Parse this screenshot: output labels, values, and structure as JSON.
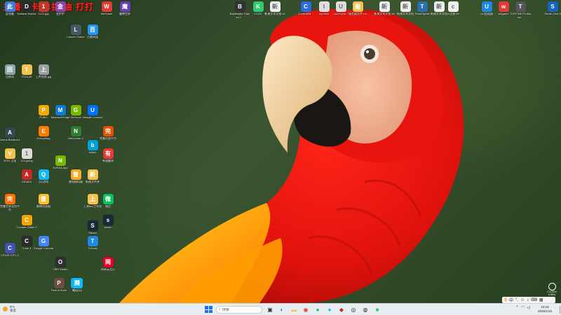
{
  "overlay": {
    "title": "主播打卡 单挑/油 打打"
  },
  "colors": {
    "overlay_red": "#ff2a2a",
    "taskbar_bg": "#e8edf2",
    "accent": "#1a73e8"
  },
  "desktop_icons": [
    {
      "label": "此电脑",
      "icon": "computer-icon",
      "color": "#3b7dd8"
    },
    {
      "label": "Darkest Mouse",
      "icon": "app-icon",
      "color": "#2b2b2b"
    },
    {
      "label": "1122.jpg",
      "icon": "image-icon",
      "color": "#c0392b"
    },
    {
      "label": "金铲铲",
      "icon": "game-icon",
      "color": "#8e44ad"
    },
    {
      "label": "WeGame",
      "icon": "wegame-icon",
      "color": "#e53935"
    },
    {
      "label": "魔兽世界",
      "icon": "game-icon",
      "color": "#6a3fb5"
    },
    {
      "label": "Battlestate Games L...",
      "icon": "launcher-icon",
      "color": "#333333"
    },
    {
      "label": "KOOK",
      "icon": "kook-icon",
      "color": "#2ecc71"
    },
    {
      "label": "新建文本文档.txt",
      "icon": "text-file-icon",
      "color": "#eeeeee"
    },
    {
      "label": "ConsoleM...",
      "icon": "file-icon",
      "color": "#2d6cdf"
    },
    {
      "label": "Inputbin",
      "icon": "file-icon",
      "color": "#dddddd"
    },
    {
      "label": "UserSyne...",
      "icon": "file-icon",
      "color": "#dddddd"
    },
    {
      "label": "服务器文件.rar",
      "icon": "folder-icon",
      "color": "#f2c14e"
    },
    {
      "label": "新建文本文档.txt",
      "icon": "text-file-icon",
      "color": "#eeeeee"
    },
    {
      "label": "新建文本文档",
      "icon": "text-file-icon",
      "color": "#eeeeee"
    },
    {
      "label": "TeamSpeak",
      "icon": "teamspeak-icon",
      "color": "#2a6fb0"
    },
    {
      "label": "新建文本文档",
      "icon": "text-file-icon",
      "color": "#eeeeee"
    },
    {
      "label": "cs注册.txt",
      "icon": "text-file-icon",
      "color": "#eeeeee"
    },
    {
      "label": "UU加速器",
      "icon": "uu-icon",
      "color": "#1e88e5"
    },
    {
      "label": "wegame",
      "icon": "wegame-icon",
      "color": "#e53935"
    },
    {
      "label": "TOPFINE Professio...",
      "icon": "app-icon",
      "color": "#555555"
    },
    {
      "label": "Studio One 6",
      "icon": "studio-icon",
      "color": "#1565c0"
    },
    {
      "label": "Steam",
      "icon": "steam-icon",
      "color": "#1b2838"
    },
    {
      "label": "QQ",
      "icon": "qq-icon",
      "color": "#12b7f5"
    },
    {
      "label": "Path of Exile",
      "icon": "game-icon",
      "color": "#6d4c41"
    },
    {
      "label": "网易云音乐",
      "icon": "music-icon",
      "color": "#e60026"
    },
    {
      "label": "Google Chrome",
      "icon": "chrome-icon",
      "color": "#4285f4"
    },
    {
      "label": "OBS Studio",
      "icon": "obs-icon",
      "color": "#302e31"
    },
    {
      "label": "Microsoft Edge",
      "icon": "edge-icon",
      "color": "#0c7cd5"
    },
    {
      "label": "Everything",
      "icon": "search-app-icon",
      "color": "#ff7b00"
    },
    {
      "label": "ToDesk",
      "icon": "todesk-icon",
      "color": "#1e88e5"
    },
    {
      "label": "bilibili",
      "icon": "bilibili-icon",
      "color": "#00a1d6"
    },
    {
      "label": "有道翻译",
      "icon": "translate-icon",
      "color": "#e53935"
    },
    {
      "label": "CPUID CPU-Z",
      "icon": "cpu-icon",
      "color": "#3f51b5"
    },
    {
      "label": "AIDA64",
      "icon": "aida-icon",
      "color": "#c62828"
    },
    {
      "label": "NVIDIA App",
      "icon": "nvidia-icon",
      "color": "#76b900"
    },
    {
      "label": "微信",
      "icon": "wechat-icon",
      "color": "#07c160"
    },
    {
      "label": "GeForce",
      "icon": "nvidia-icon",
      "color": "#76b900"
    },
    {
      "label": "雷电模拟器",
      "icon": "emulator-icon",
      "color": "#f9a825"
    },
    {
      "label": "Cube 4",
      "icon": "app-icon",
      "color": "#2b2b2b"
    },
    {
      "label": "QQ游戏",
      "icon": "qq-icon",
      "color": "#12b7f5"
    },
    {
      "label": "回收站",
      "icon": "recycle-bin-icon",
      "color": "#90a4ae"
    },
    {
      "label": "TOOLsE",
      "icon": "folder-icon",
      "color": "#f2c14e"
    },
    {
      "label": "上传视频.jpg",
      "icon": "image-icon",
      "color": "#9e9e9e"
    },
    {
      "label": "VEIN 汉化",
      "icon": "folder-icon",
      "color": "#f2c14e"
    },
    {
      "label": "123.jpdog",
      "icon": "file-icon",
      "color": "#dddddd"
    },
    {
      "label": "Arena Breakout",
      "icon": "game-icon",
      "color": "#37474f"
    },
    {
      "label": "PUBG",
      "icon": "game-icon",
      "color": "#f2a900"
    },
    {
      "label": "完美世界竞技平台",
      "icon": "game-icon",
      "color": "#ff6f00"
    },
    {
      "label": "腾讯QQ",
      "icon": "qq-icon",
      "color": "#12b7f5"
    },
    {
      "label": "Launch Game",
      "icon": "launcher-icon",
      "color": "#455a64"
    },
    {
      "label": "百度网盘",
      "icon": "cloud-icon",
      "color": "#2196f3"
    },
    {
      "label": "NetLimiter 4",
      "icon": "netlimiter-icon",
      "color": "#2e7d32"
    },
    {
      "label": "Ubisoft Connect",
      "icon": "ubisoft-icon",
      "color": "#0070ff"
    },
    {
      "label": "完美对战平台",
      "icon": "game-icon",
      "color": "#e65100"
    },
    {
      "label": "Counter-Strike 2",
      "icon": "cs2-icon",
      "color": "#f4a300"
    },
    {
      "label": "新建文件夹",
      "icon": "folder-icon",
      "color": "#f2c14e"
    },
    {
      "label": "上海mix工作站",
      "icon": "folder-icon",
      "color": "#f2c14e"
    },
    {
      "label": "雷神加速器",
      "icon": "game-icon",
      "color": "#fbc02d"
    },
    {
      "label": "steam",
      "icon": "steam-icon",
      "color": "#1b2838"
    }
  ],
  "taskbar": {
    "weather_temp": "9°C",
    "weather_desc": "多云",
    "search_placeholder": "搜索",
    "ime_label": "中",
    "clock_time": "23:18",
    "clock_date": "2025/1/16"
  },
  "widget": {
    "label": "C:0.1K/s 0.5K/s"
  }
}
